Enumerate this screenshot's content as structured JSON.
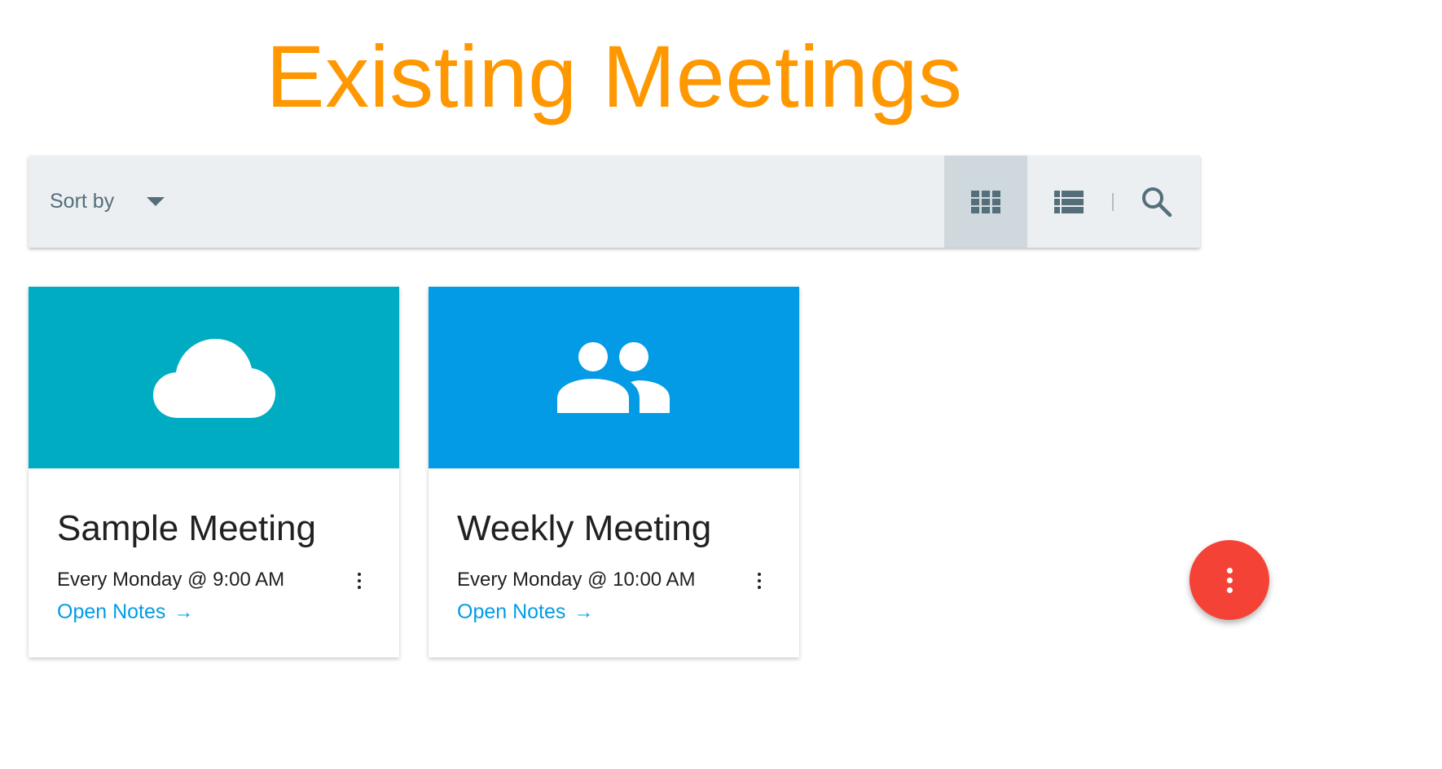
{
  "page": {
    "title": "Existing Meetings"
  },
  "toolbar": {
    "sort_label": "Sort by",
    "icons": {
      "grid_view": "grid-view-icon",
      "list_view": "list-view-icon",
      "search": "search-icon",
      "sort_dropdown": "dropdown-arrow-icon"
    },
    "active_view": "grid"
  },
  "cards": [
    {
      "title": "Sample Meeting",
      "schedule": "Every Monday @ 9:00 AM",
      "link": "Open Notes",
      "icon": "cloud-icon",
      "color": "#00acc1"
    },
    {
      "title": "Weekly Meeting",
      "schedule": "Every Monday @ 10:00 AM",
      "link": "Open Notes",
      "icon": "people-icon",
      "color": "#039be5"
    }
  ],
  "fab": {
    "icon": "more-vert-icon",
    "color": "#f44336"
  },
  "colors": {
    "title": "#ff9800",
    "link": "#039be5",
    "toolbar_bg": "#eceff1",
    "toolbar_icon": "#546e7a"
  }
}
